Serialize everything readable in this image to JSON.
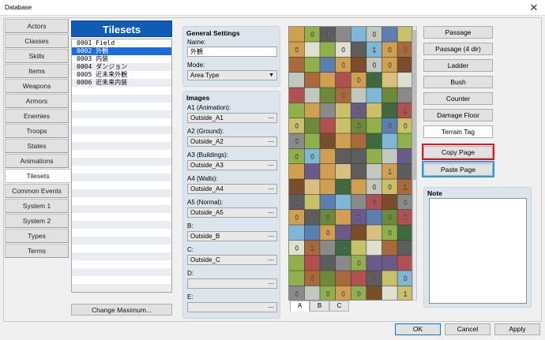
{
  "window": {
    "title": "Database",
    "close_glyph": "✕"
  },
  "categories": [
    {
      "label": "Actors"
    },
    {
      "label": "Classes"
    },
    {
      "label": "Skills"
    },
    {
      "label": "Items"
    },
    {
      "label": "Weapons"
    },
    {
      "label": "Armors"
    },
    {
      "label": "Enemies"
    },
    {
      "label": "Troops"
    },
    {
      "label": "States"
    },
    {
      "label": "Animations"
    },
    {
      "label": "Tilesets",
      "active": true
    },
    {
      "label": "Common Events"
    },
    {
      "label": "System 1"
    },
    {
      "label": "System 2"
    },
    {
      "label": "Types"
    },
    {
      "label": "Terms"
    }
  ],
  "tileset_list": {
    "header": "Tilesets",
    "items": [
      {
        "text": "0001 Field"
      },
      {
        "text": "0002 外観",
        "selected": true
      },
      {
        "text": "0003 内装"
      },
      {
        "text": "0004 ダンジョン"
      },
      {
        "text": "0005 近未来外観"
      },
      {
        "text": "0006 近未来内装"
      }
    ],
    "change_max_label": "Change Maximum..."
  },
  "general": {
    "title": "General Settings",
    "name_label": "Name:",
    "name_value": "外観",
    "mode_label": "Mode:",
    "mode_value": "Area Type"
  },
  "images": {
    "title": "Images",
    "slots": [
      {
        "label": "A1 (Animation):",
        "value": "Outside_A1"
      },
      {
        "label": "A2 (Ground):",
        "value": "Outside_A2"
      },
      {
        "label": "A3 (Buildings):",
        "value": "Outside_A3"
      },
      {
        "label": "A4 (Walls):",
        "value": "Outside_A4"
      },
      {
        "label": "A5 (Normal):",
        "value": "Outside_A5"
      },
      {
        "label": "B:",
        "value": "Outside_B"
      },
      {
        "label": "C:",
        "value": "Outside_C"
      },
      {
        "label": "D:",
        "value": ""
      },
      {
        "label": "E:",
        "value": ""
      }
    ],
    "browse_glyph": "..."
  },
  "tile_tabs": [
    {
      "label": "A",
      "active": true
    },
    {
      "label": "B"
    },
    {
      "label": "C"
    }
  ],
  "tile_marks": [
    "0",
    "1"
  ],
  "right_buttons": {
    "passage": "Passage",
    "passage4": "Passage (4 dir)",
    "ladder": "Ladder",
    "bush": "Bush",
    "counter": "Counter",
    "damage_floor": "Damage Floor",
    "terrain_tag": "Terrain Tag",
    "copy_page": "Copy Page",
    "paste_page": "Paste Page"
  },
  "note": {
    "title": "Note"
  },
  "bottom": {
    "ok": "OK",
    "cancel": "Cancel",
    "apply": "Apply"
  },
  "colors": {
    "highlight_red": "#e8101c",
    "highlight_blue": "#1ea0e6",
    "list_header": "#0f5bb5",
    "selection": "#1c6ed6"
  }
}
